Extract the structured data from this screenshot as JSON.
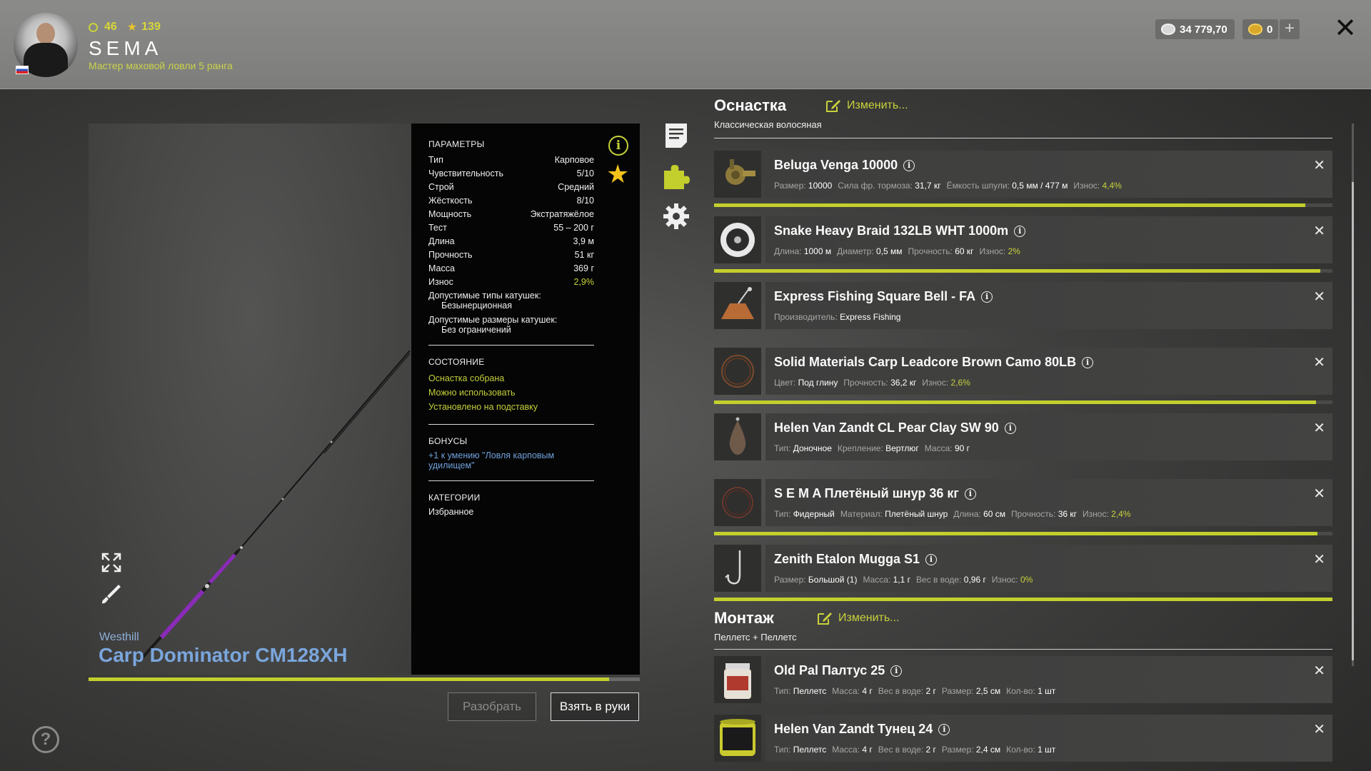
{
  "header": {
    "level": "46",
    "stars": "139",
    "username": "SEMA",
    "rank": "Мастер маховой ловли 5 ранга",
    "silver": "34 779,70",
    "gold": "0"
  },
  "rod": {
    "brand": "Westhill",
    "name": "Carp Dominator CM128XH",
    "wear_fraction": 0.944
  },
  "params": {
    "title": "ПАРАМЕТРЫ",
    "rows": [
      {
        "k": "Тип",
        "v": "Карповое"
      },
      {
        "k": "Чувствительность",
        "v": "5/10"
      },
      {
        "k": "Строй",
        "v": "Средний"
      },
      {
        "k": "Жёсткость",
        "v": "8/10"
      },
      {
        "k": "Мощность",
        "v": "Экстратяжёлое"
      },
      {
        "k": "Тест",
        "v": "55 – 200 г"
      },
      {
        "k": "Длина",
        "v": "3,9 м"
      },
      {
        "k": "Прочность",
        "v": "51 кг"
      },
      {
        "k": "Масса",
        "v": "369 г"
      },
      {
        "k": "Износ",
        "v": "2,9%"
      }
    ],
    "reel_types_label": "Допустимые типы катушек:",
    "reel_types_value": "Безынерционная",
    "reel_sizes_label": "Допустимые размеры катушек:",
    "reel_sizes_value": "Без ограничений",
    "state_title": "СОСТОЯНИЕ",
    "state": [
      "Оснастка собрана",
      "Можно использовать",
      "Установлено на подставку"
    ],
    "bonus_title": "БОНУСЫ",
    "bonus_line1": "+1 к умению \"Ловля карповым",
    "bonus_line2": "удилищем\"",
    "cat_title": "КАТЕГОРИИ",
    "cat_value": "Избранное"
  },
  "buttons": {
    "disassemble": "Разобрать",
    "take": "Взять в руки"
  },
  "tackle": {
    "title": "Оснастка",
    "edit": "Изменить...",
    "subtitle": "Классическая волосяная",
    "items": [
      {
        "name": "Beluga Venga 10000",
        "wear": 0.956,
        "desc": [
          [
            "Размер:",
            "10000"
          ],
          [
            "Сила фр. тормоза:",
            "31,7 кг"
          ],
          [
            "Ёмкость шпули:",
            "0,5 мм / 477 м"
          ],
          [
            "Износ:",
            "4,4%",
            "g"
          ]
        ]
      },
      {
        "name": "Snake Heavy Braid 132LB WHT 1000m",
        "wear": 0.98,
        "desc": [
          [
            "Длина:",
            "1000 м"
          ],
          [
            "Диаметр:",
            "0,5 мм"
          ],
          [
            "Прочность:",
            "60 кг"
          ],
          [
            "Износ:",
            "2%",
            "g"
          ]
        ]
      },
      {
        "name": "Express Fishing Square Bell - FA",
        "desc": [
          [
            "Производитель:",
            "Express Fishing"
          ]
        ]
      },
      {
        "name": "Solid Materials Carp Leadcore Brown Camo 80LB",
        "wear": 0.974,
        "desc": [
          [
            "Цвет:",
            "Под глину"
          ],
          [
            "Прочность:",
            "36,2 кг"
          ],
          [
            "Износ:",
            "2,6%",
            "g"
          ]
        ]
      },
      {
        "name": "Helen Van Zandt CL Pear Clay SW 90",
        "desc": [
          [
            "Тип:",
            "Доночное"
          ],
          [
            "Крепление:",
            "Вертлюг"
          ],
          [
            "Масса:",
            "90 г"
          ]
        ]
      },
      {
        "name": "S E M A Плетёный шнур 36 кг",
        "wear": 0.976,
        "desc": [
          [
            "Тип:",
            "Фидерный"
          ],
          [
            "Материал:",
            "Плетёный шнур"
          ],
          [
            "Длина:",
            "60 см"
          ],
          [
            "Прочность:",
            "36 кг"
          ],
          [
            "Износ:",
            "2,4%",
            "g"
          ]
        ]
      },
      {
        "name": "Zenith Etalon Mugga S1",
        "wear": 1.0,
        "desc": [
          [
            "Размер:",
            "Большой (1)"
          ],
          [
            "Масса:",
            "1,1 г"
          ],
          [
            "Вес в воде:",
            "0,96 г"
          ],
          [
            "Износ:",
            "0%",
            "g"
          ]
        ]
      }
    ]
  },
  "montage": {
    "title": "Монтаж",
    "edit": "Изменить...",
    "subtitle": "Пеллетс  +  Пеллетс",
    "items": [
      {
        "name": "Old Pal Палтус 25",
        "desc": [
          [
            "Тип:",
            "Пеллетс"
          ],
          [
            "Масса:",
            "4 г"
          ],
          [
            "Вес в воде:",
            "2 г"
          ],
          [
            "Размер:",
            "2,5 см"
          ],
          [
            "Кол-во:",
            "1 шт"
          ]
        ]
      },
      {
        "name": "Helen Van Zandt Тунец 24",
        "desc": [
          [
            "Тип:",
            "Пеллетс"
          ],
          [
            "Масса:",
            "4 г"
          ],
          [
            "Вес в воде:",
            "2 г"
          ],
          [
            "Размер:",
            "2,4 см"
          ],
          [
            "Кол-во:",
            "1 шт"
          ]
        ]
      }
    ]
  },
  "colors": {
    "accent": "#c8d23a",
    "blue": "#7aa6dc",
    "star": "#f2c21a"
  },
  "icons": [
    "notes-icon",
    "puzzle-icon",
    "gear-icon",
    "info-icon",
    "star-icon",
    "expand-icon",
    "brush-icon",
    "help-icon",
    "close-icon",
    "edit-icon"
  ]
}
